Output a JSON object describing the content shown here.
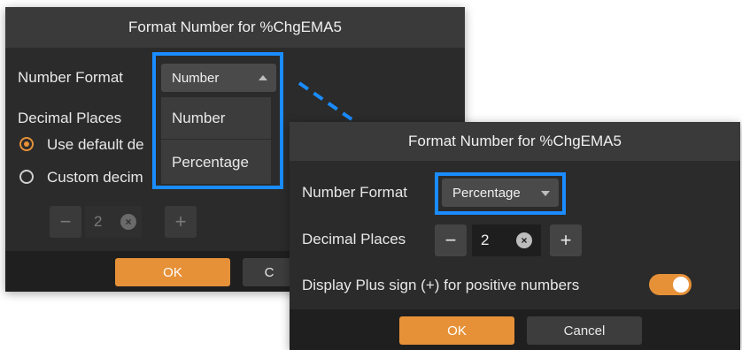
{
  "left_dialog": {
    "title": "Format Number for %ChgEMA5",
    "number_format_label": "Number Format",
    "number_format_value": "Number",
    "dropdown_options": [
      "Number",
      "Percentage"
    ],
    "decimal_places_label": "Decimal Places",
    "radio_default_label": "Use default de",
    "radio_custom_label": "Custom decim",
    "stepper_value": "2",
    "stepper_minus": "−",
    "stepper_plus": "+",
    "stepper_clear": "×",
    "ok_label": "OK",
    "cancel_label": "C"
  },
  "right_dialog": {
    "title": "Format Number for %ChgEMA5",
    "number_format_label": "Number Format",
    "number_format_value": "Percentage",
    "decimal_places_label": "Decimal Places",
    "stepper_value": "2",
    "stepper_minus": "−",
    "stepper_plus": "+",
    "stepper_clear": "×",
    "plus_sign_label": "Display Plus sign (+) for positive numbers",
    "plus_sign_enabled": true,
    "ok_label": "OK",
    "cancel_label": "Cancel"
  },
  "colors": {
    "accent": "#e69138",
    "highlight": "#1a8cff",
    "dialog_bg": "#2b2b2b"
  }
}
